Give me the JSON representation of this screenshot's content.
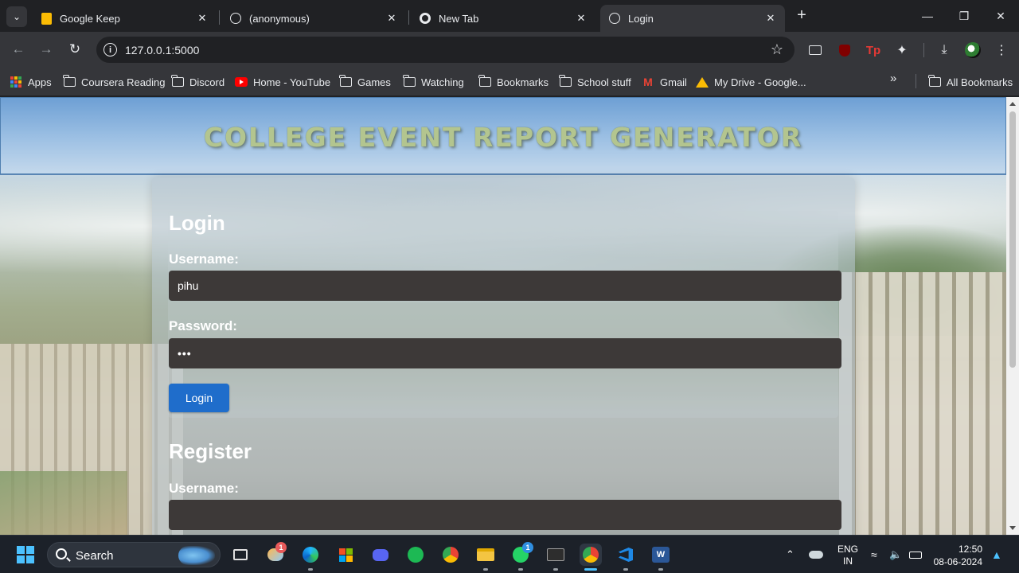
{
  "browser": {
    "tabs": [
      {
        "title": "Google Keep",
        "icon": "keep-icon",
        "active": false
      },
      {
        "title": "(anonymous)",
        "icon": "globe-icon",
        "active": false
      },
      {
        "title": "New Tab",
        "icon": "chrome-icon",
        "active": false
      },
      {
        "title": "Login",
        "icon": "globe-icon",
        "active": true
      }
    ],
    "url": "127.0.0.1:5000",
    "bookmarks": [
      {
        "label": "Apps",
        "icon": "apps-grid-icon"
      },
      {
        "label": "Coursera Reading",
        "icon": "folder-icon"
      },
      {
        "label": "Discord",
        "icon": "folder-icon"
      },
      {
        "label": "Home - YouTube",
        "icon": "youtube-icon"
      },
      {
        "label": "Games",
        "icon": "folder-icon"
      },
      {
        "label": "Watching",
        "icon": "folder-icon"
      },
      {
        "label": "Bookmarks",
        "icon": "folder-icon"
      },
      {
        "label": "School stuff",
        "icon": "folder-icon"
      },
      {
        "label": "Gmail",
        "icon": "gmail-icon"
      },
      {
        "label": "My Drive - Google...",
        "icon": "drive-icon"
      }
    ],
    "all_bookmarks": "All Bookmarks"
  },
  "page": {
    "site_title": "COLLEGE EVENT REPORT GENERATOR",
    "login": {
      "heading": "Login",
      "username_label": "Username:",
      "username_value": "pihu",
      "password_label": "Password:",
      "password_value": "•••",
      "button": "Login"
    },
    "register": {
      "heading": "Register",
      "username_label": "Username:",
      "username_value": ""
    }
  },
  "taskbar": {
    "search": "Search",
    "badges": {
      "weather": "1",
      "whatsapp": "1"
    },
    "lang_line1": "ENG",
    "lang_line2": "IN",
    "time": "12:50",
    "date": "08-06-2024"
  },
  "colors": {
    "accent_blue": "#1f6dcb",
    "input_bg": "#3d3938",
    "title_green": "#b3c58f"
  }
}
